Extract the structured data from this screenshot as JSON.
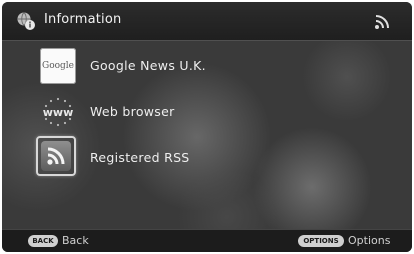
{
  "header": {
    "title": "Information",
    "title_icon": "globe-info-icon",
    "right_icon": "rss-signal-icon"
  },
  "items": [
    {
      "label": "Google News U.K.",
      "icon": "google-icon",
      "icon_text": "Google"
    },
    {
      "label": "Web browser",
      "icon": "www-icon",
      "icon_text": "www"
    },
    {
      "label": "Registered RSS",
      "icon": "rss-icon",
      "selected": true
    }
  ],
  "footer": {
    "back": {
      "button": "BACK",
      "label": "Back"
    },
    "options": {
      "button": "OPTIONS",
      "label": "Options"
    }
  }
}
